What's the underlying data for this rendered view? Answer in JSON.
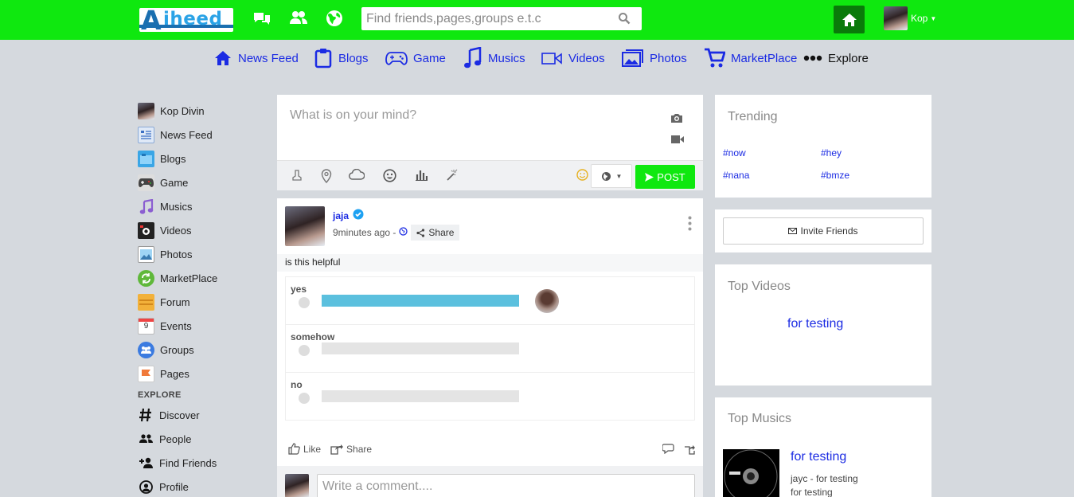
{
  "colors": {
    "brand_green": "#0fe80f",
    "link_blue": "#1b2be3",
    "poll_fill": "#5bc0de"
  },
  "header": {
    "logo_first": "A",
    "logo_rest": "iheed",
    "search_placeholder": "Find friends,pages,groups e.t.c",
    "user_name": "Kop",
    "icons": [
      "messages-icon",
      "friends-icon",
      "globe-icon",
      "search-icon",
      "home-icon"
    ]
  },
  "nav": [
    {
      "label": "News Feed",
      "icon": "home-icon"
    },
    {
      "label": "Blogs",
      "icon": "clipboard-icon"
    },
    {
      "label": "Game",
      "icon": "gamepad-icon"
    },
    {
      "label": "Musics",
      "icon": "music-note-icon"
    },
    {
      "label": "Videos",
      "icon": "video-camera-icon"
    },
    {
      "label": "Photos",
      "icon": "photos-icon"
    },
    {
      "label": "MarketPlace",
      "icon": "cart-icon"
    },
    {
      "label": "Explore",
      "icon": "more-dots-icon"
    }
  ],
  "sidebar": {
    "items": [
      {
        "label": "Kop Divin",
        "icon": "user-avatar"
      },
      {
        "label": "News Feed",
        "icon": "newsfeed-icon"
      },
      {
        "label": "Blogs",
        "icon": "blog-icon"
      },
      {
        "label": "Game",
        "icon": "game-icon"
      },
      {
        "label": "Musics",
        "icon": "music-icon"
      },
      {
        "label": "Videos",
        "icon": "video-icon"
      },
      {
        "label": "Photos",
        "icon": "photo-icon"
      },
      {
        "label": "MarketPlace",
        "icon": "marketplace-icon"
      },
      {
        "label": "Forum",
        "icon": "forum-icon"
      },
      {
        "label": "Events",
        "icon": "calendar-icon",
        "badge": "9"
      },
      {
        "label": "Groups",
        "icon": "groups-icon"
      },
      {
        "label": "Pages",
        "icon": "flag-icon"
      }
    ],
    "explore_heading": "EXPLORE",
    "explore": [
      {
        "label": "Discover",
        "icon": "hashtag-icon"
      },
      {
        "label": "People",
        "icon": "people-icon"
      },
      {
        "label": "Find Friends",
        "icon": "add-person-icon"
      },
      {
        "label": "Profile",
        "icon": "profile-icon"
      }
    ]
  },
  "composer": {
    "placeholder": "What is on your mind?",
    "post_label": "POST"
  },
  "post": {
    "author": "jaja",
    "time": "9minutes ago -",
    "share_chip": "Share",
    "text": "is this helpful",
    "poll": [
      {
        "label": "yes",
        "fill": 1.0,
        "has_voter": true
      },
      {
        "label": "somehow",
        "fill": 0.0,
        "has_voter": false
      },
      {
        "label": "no",
        "fill": 0.0,
        "has_voter": false
      }
    ],
    "like_label": "Like",
    "share_label": "Share",
    "comment_placeholder": "Write a comment...."
  },
  "trending": {
    "title": "Trending",
    "tags": [
      "#now",
      "#hey",
      "#nana",
      "#bmze"
    ]
  },
  "invite": {
    "label": "Invite Friends"
  },
  "top_videos": {
    "title": "Top Videos",
    "item": "for testing"
  },
  "top_musics": {
    "title": "Top Musics",
    "item_title": "for testing",
    "item_sub": "jayc - for testing",
    "item_sub2": "for testing"
  }
}
